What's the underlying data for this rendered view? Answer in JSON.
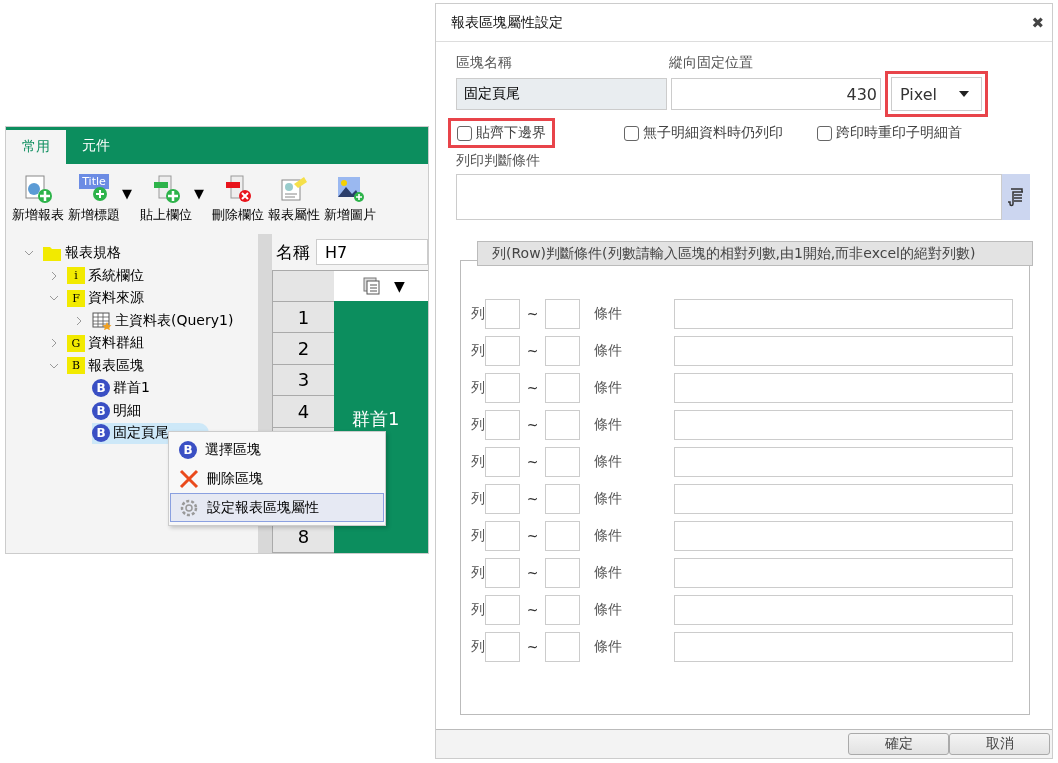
{
  "designer": {
    "tabs": [
      {
        "label": "常用",
        "selected": true
      },
      {
        "label": "元件",
        "selected": false
      }
    ],
    "toolbar": [
      {
        "label": "新增報表",
        "kind": "report"
      },
      {
        "label": "新增標題",
        "kind": "title",
        "icon_text": "Title",
        "dropdown": "▼"
      },
      {
        "label": "貼上欄位",
        "kind": "paste",
        "dropdown": "▼"
      },
      {
        "label": "刪除欄位",
        "kind": "delete"
      },
      {
        "label": "報表屬性",
        "kind": "props"
      },
      {
        "label": "新增圖片",
        "kind": "image"
      }
    ],
    "tree": [
      {
        "label": "報表規格",
        "kind": "folder",
        "expanded": true,
        "selected": false,
        "children": [
          {
            "label": "系統欄位",
            "kind": "folder",
            "badge": "i",
            "expanded": false,
            "selected": false
          },
          {
            "label": "資料來源",
            "kind": "folder",
            "badge": "F",
            "expanded": true,
            "selected": false,
            "children": [
              {
                "label": "主資料表(Query1)",
                "kind": "table",
                "expanded": false,
                "selected": false
              }
            ]
          },
          {
            "label": "資料群組",
            "kind": "folder",
            "badge": "G",
            "expanded": false,
            "selected": false
          },
          {
            "label": "報表區塊",
            "kind": "folder",
            "badge": "B",
            "expanded": true,
            "selected": false,
            "children": [
              {
                "label": "群首1",
                "kind": "block",
                "badge": "B",
                "selected": false
              },
              {
                "label": "明細",
                "kind": "block",
                "badge": "B",
                "selected": false
              },
              {
                "label": "固定頁尾",
                "kind": "block",
                "badge": "B",
                "selected": true
              }
            ]
          }
        ]
      }
    ],
    "name_label": "名稱",
    "name_value": "H7",
    "column_menu": "▼",
    "row_headers": [
      "1",
      "2",
      "3",
      "4",
      "8"
    ],
    "cell_text": "群首1",
    "context_menu": [
      {
        "label": "選擇區塊",
        "kind": "block",
        "badge": "B",
        "selected": false
      },
      {
        "label": "刪除區塊",
        "kind": "delete",
        "selected": false
      },
      {
        "label": "設定報表區塊屬性",
        "kind": "settings",
        "selected": true
      }
    ]
  },
  "dialog": {
    "title": "報表區塊屬性設定",
    "close": "✖",
    "block_name_label": "區塊名稱",
    "block_name_value": "固定頁尾",
    "position_label": "縱向固定位置",
    "position_value": "430",
    "unit": {
      "value": "Pixel",
      "highlighted": true
    },
    "checkboxes": [
      {
        "label": "貼齊下邊界",
        "checked": false,
        "highlighted": true
      },
      {
        "label": "無子明細資料時仍列印",
        "checked": false,
        "highlighted": false
      },
      {
        "label": "跨印時重印子明細首",
        "checked": false,
        "highlighted": false
      }
    ],
    "print_condition_label": "列印判斷條件",
    "legend": "列(Row)判斷條件(列數請輸入區塊的相對列數,由1開始,而非excel的絕對列數)",
    "conditions": [
      {
        "row_label": "列",
        "tilde": "~",
        "cond_label": "條件"
      },
      {
        "row_label": "列",
        "tilde": "~",
        "cond_label": "條件"
      },
      {
        "row_label": "列",
        "tilde": "~",
        "cond_label": "條件"
      },
      {
        "row_label": "列",
        "tilde": "~",
        "cond_label": "條件"
      },
      {
        "row_label": "列",
        "tilde": "~",
        "cond_label": "條件"
      },
      {
        "row_label": "列",
        "tilde": "~",
        "cond_label": "條件"
      },
      {
        "row_label": "列",
        "tilde": "~",
        "cond_label": "條件"
      },
      {
        "row_label": "列",
        "tilde": "~",
        "cond_label": "條件"
      },
      {
        "row_label": "列",
        "tilde": "~",
        "cond_label": "條件"
      },
      {
        "row_label": "列",
        "tilde": "~",
        "cond_label": "條件"
      }
    ],
    "buttons": [
      "確定",
      "取消"
    ]
  }
}
